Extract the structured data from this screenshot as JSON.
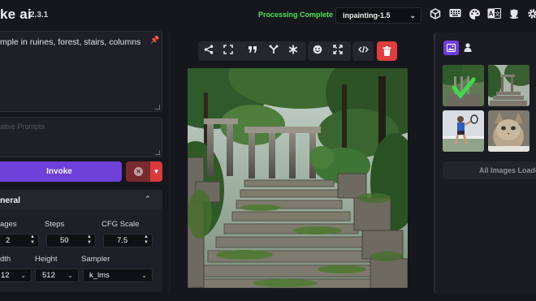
{
  "header": {
    "brand": "ke ai",
    "version": "2.3.1",
    "status": "Processing Complete",
    "model": "inpainting-1.5",
    "icons": [
      "cube-icon",
      "keyboard-icon",
      "palette-icon",
      "translate-icon",
      "github-icon",
      "settings-icon"
    ]
  },
  "prompt": {
    "text": "mple in ruines, forest, stairs, columns",
    "negative_placeholder": "ative Prompts"
  },
  "actions": {
    "invoke": "Invoke"
  },
  "general": {
    "title": "neral",
    "labels": {
      "images": "ages",
      "steps": "Steps",
      "cfg": "CFG Scale",
      "width": "dth",
      "height": "Height",
      "sampler": "Sampler"
    },
    "values": {
      "images": "2",
      "steps": "50",
      "cfg": "7.5",
      "width": "12",
      "height": "512",
      "sampler": "k_lms"
    }
  },
  "gallery": {
    "all_loaded": "All Images Loade"
  },
  "colors": {
    "accent": "#6f3fd9",
    "danger": "#e03d3d",
    "status": "#4be45a",
    "background": "#16171d"
  }
}
